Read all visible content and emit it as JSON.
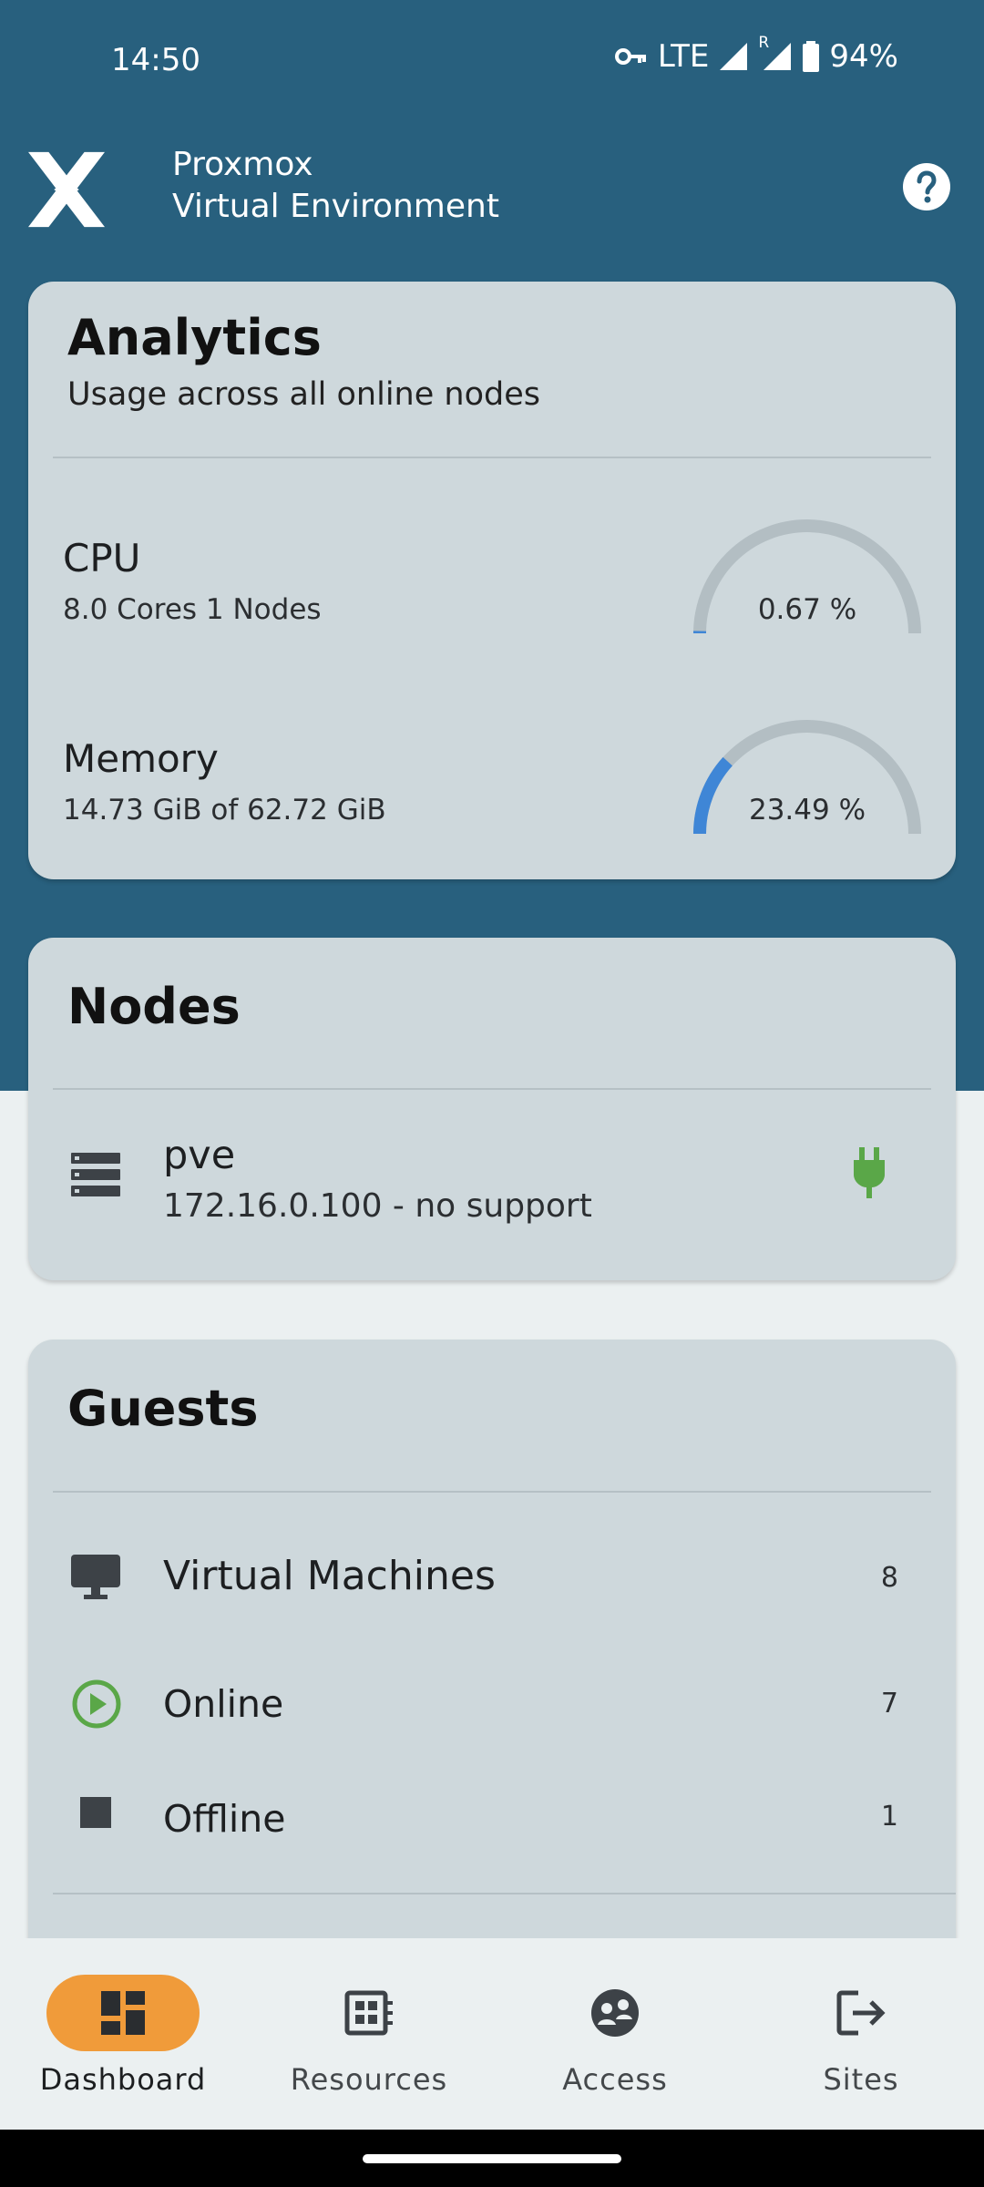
{
  "status_bar": {
    "time": "14:50",
    "network": "LTE",
    "roaming": "R",
    "battery": "94%"
  },
  "app_bar": {
    "title_line1": "Proxmox",
    "title_line2": "Virtual Environment"
  },
  "analytics": {
    "title": "Analytics",
    "subtitle": "Usage across all online nodes",
    "cpu": {
      "label": "CPU",
      "detail": "8.0 Cores 1 Nodes",
      "percent_text": "0.67 %",
      "fraction": 0.0067
    },
    "memory": {
      "label": "Memory",
      "detail": "14.73 GiB of 62.72 GiB",
      "percent_text": "23.49 %",
      "fraction": 0.2349
    }
  },
  "nodes": {
    "title": "Nodes",
    "items": [
      {
        "name": "pve",
        "detail": "172.16.0.100 - no support",
        "status_icon": "plug-icon"
      }
    ]
  },
  "guests": {
    "title": "Guests",
    "rows": [
      {
        "label": "Virtual Machines",
        "count": "8",
        "icon": "monitor-icon"
      },
      {
        "label": "Online",
        "count": "7",
        "icon": "play-circle-icon"
      },
      {
        "label": "Offline",
        "count": "1",
        "icon": "stop-icon"
      }
    ]
  },
  "bottom_nav": {
    "items": [
      {
        "label": "Dashboard",
        "icon": "dashboard-icon",
        "active": true
      },
      {
        "label": "Resources",
        "icon": "resources-icon",
        "active": false
      },
      {
        "label": "Access",
        "icon": "access-icon",
        "active": false
      },
      {
        "label": "Sites",
        "icon": "sites-icon",
        "active": false
      }
    ]
  },
  "colors": {
    "header": "#28607e",
    "card": "#ced8dc",
    "gauge_track": "#b3bec3",
    "gauge_fill": "#3f86d6",
    "online_green": "#5aa748",
    "nav_active": "#f09b3a"
  }
}
